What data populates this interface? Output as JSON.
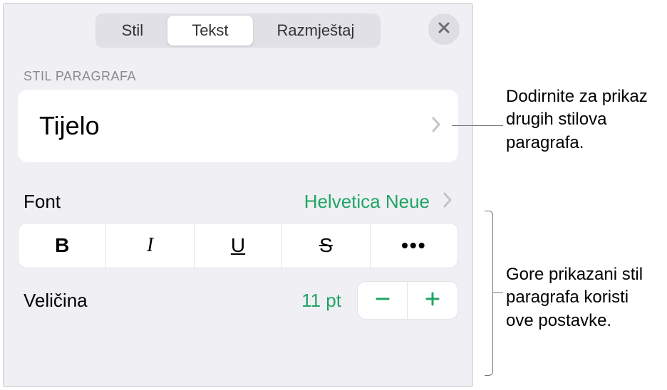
{
  "tabs": {
    "stil": "Stil",
    "tekst": "Tekst",
    "razmjestaj": "Razmještaj"
  },
  "section": {
    "paragraph_style_label": "STIL PARAGRAFA",
    "current_style": "Tijelo"
  },
  "font": {
    "label": "Font",
    "value": "Helvetica Neue"
  },
  "format": {
    "bold": "B",
    "italic": "I",
    "underline": "U",
    "strike": "S",
    "more": "•••"
  },
  "size": {
    "label": "Veličina",
    "value": "11 pt"
  },
  "callouts": {
    "style_chevron": "Dodirnite za prikaz drugih stilova paragrafa.",
    "font_settings": "Gore prikazani stil paragrafa koristi ove postavke."
  },
  "colors": {
    "accent": "#1ea664"
  }
}
